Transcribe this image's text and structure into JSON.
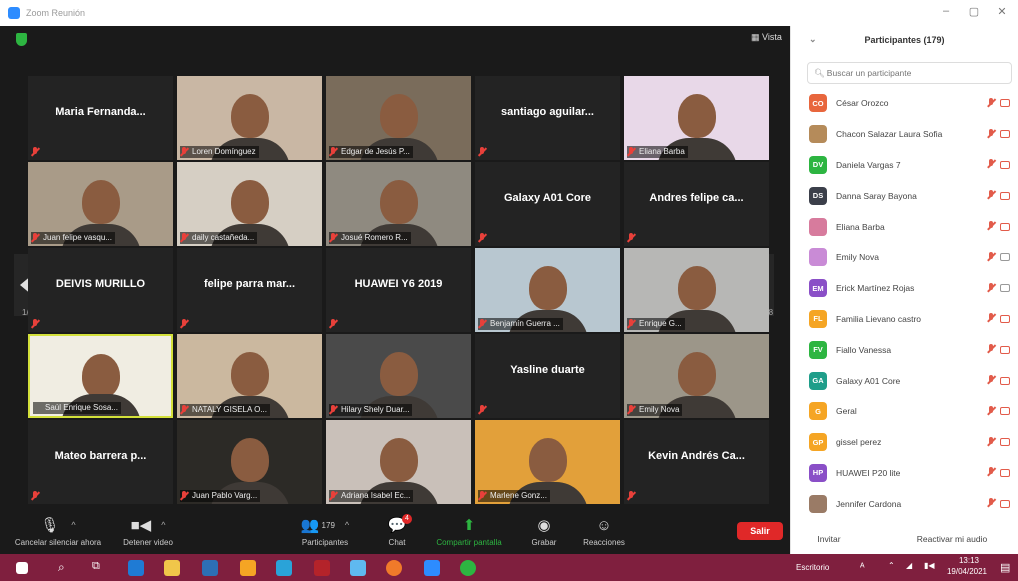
{
  "window": {
    "title": "Zoom Reunión"
  },
  "meeting": {
    "view_label": "Vista",
    "page_left": "1/8",
    "page_right": "1/8",
    "tiles": [
      {
        "name": "Maria Fernanda...",
        "type": "name",
        "muted": true
      },
      {
        "name": "Loren Domínguez",
        "type": "video",
        "muted": true
      },
      {
        "name": "Edgar de Jesús P...",
        "type": "video",
        "muted": true
      },
      {
        "name": "santiago aguilar...",
        "type": "name",
        "muted": true
      },
      {
        "name": "Eliana Barba",
        "type": "video",
        "muted": true
      },
      {
        "name": "Juan felipe vasqu...",
        "type": "video",
        "muted": true
      },
      {
        "name": "daily castañeda...",
        "type": "video",
        "muted": true
      },
      {
        "name": "Josué Romero R...",
        "type": "video",
        "muted": true
      },
      {
        "name": "Galaxy A01 Core",
        "type": "name",
        "muted": true
      },
      {
        "name": "Andres felipe ca...",
        "type": "name",
        "muted": true
      },
      {
        "name": "DEIVIS MURILLO",
        "type": "name",
        "muted": true
      },
      {
        "name": "felipe parra mar...",
        "type": "name",
        "muted": true
      },
      {
        "name": "HUAWEI Y6 2019",
        "type": "name",
        "muted": true
      },
      {
        "name": "Benjamín Guerra ...",
        "type": "video",
        "muted": true
      },
      {
        "name": "Enrique G...",
        "type": "video",
        "muted": true
      },
      {
        "name": "Saúl Enrique Sosa...",
        "type": "video",
        "muted": false,
        "active": true
      },
      {
        "name": "NATALY GISELA O...",
        "type": "video",
        "muted": true
      },
      {
        "name": "Hilary Shely Duar...",
        "type": "video",
        "muted": true
      },
      {
        "name": "Yasline duarte",
        "type": "name",
        "muted": true
      },
      {
        "name": "Emily Nova",
        "type": "video",
        "muted": true
      },
      {
        "name": "Mateo barrera p...",
        "type": "name",
        "muted": true
      },
      {
        "name": "Juan Pablo Varg...",
        "type": "video",
        "muted": true
      },
      {
        "name": "Adriana Isabel Ec...",
        "type": "video",
        "muted": true
      },
      {
        "name": "Marlene Gonz...",
        "type": "video",
        "muted": true
      },
      {
        "name": "Kevin Andrés Ca...",
        "type": "name",
        "muted": true
      }
    ]
  },
  "toolbar": {
    "unmute": "Cancelar silenciar ahora",
    "stop_video": "Detener video",
    "participants": "Participantes",
    "participants_count": "179",
    "chat": "Chat",
    "chat_badge": "4",
    "share": "Compartir pantalla",
    "record": "Grabar",
    "reactions": "Reacciones",
    "leave": "Salir"
  },
  "panel": {
    "title": "Participantes (179)",
    "search_placeholder": "Buscar un participante",
    "participants": [
      {
        "initials": "CO",
        "name": "César Orozco",
        "color": "#e8663d",
        "cam": "on"
      },
      {
        "initials": "",
        "name": "Chacon Salazar Laura Sofia",
        "color": "#b58b5a",
        "cam": "on"
      },
      {
        "initials": "DV",
        "name": "Daniela Vargas 7",
        "color": "#2db541",
        "cam": "on"
      },
      {
        "initials": "DS",
        "name": "Danna Saray Bayona",
        "color": "#3b3f4a",
        "cam": "on"
      },
      {
        "initials": "",
        "name": "Eliana Barba",
        "color": "#d77b9d",
        "cam": "on"
      },
      {
        "initials": "",
        "name": "Emily Nova",
        "color": "#c98bd6",
        "cam": "off"
      },
      {
        "initials": "EM",
        "name": "Erick Martínez Rojas",
        "color": "#8a4fc7",
        "cam": "off"
      },
      {
        "initials": "FL",
        "name": "Familia Lievano castro",
        "color": "#f5a524",
        "cam": "on"
      },
      {
        "initials": "FV",
        "name": "Fiallo Vanessa",
        "color": "#2db541",
        "cam": "on"
      },
      {
        "initials": "GA",
        "name": "Galaxy A01 Core",
        "color": "#1f9e8a",
        "cam": "on"
      },
      {
        "initials": "G",
        "name": "Geral",
        "color": "#f5a524",
        "cam": "on"
      },
      {
        "initials": "GP",
        "name": "gissel perez",
        "color": "#f5a524",
        "cam": "on"
      },
      {
        "initials": "HP",
        "name": "HUAWEI P20 lite",
        "color": "#8a4fc7",
        "cam": "on"
      },
      {
        "initials": "",
        "name": "Jennifer Cardona",
        "color": "#9a7b66",
        "cam": "on"
      }
    ],
    "invite": "Invitar",
    "reactivate": "Reactivar mi audio"
  },
  "taskbar": {
    "desktop": "Escritorio",
    "time": "13:13",
    "date": "19/04/2021"
  }
}
